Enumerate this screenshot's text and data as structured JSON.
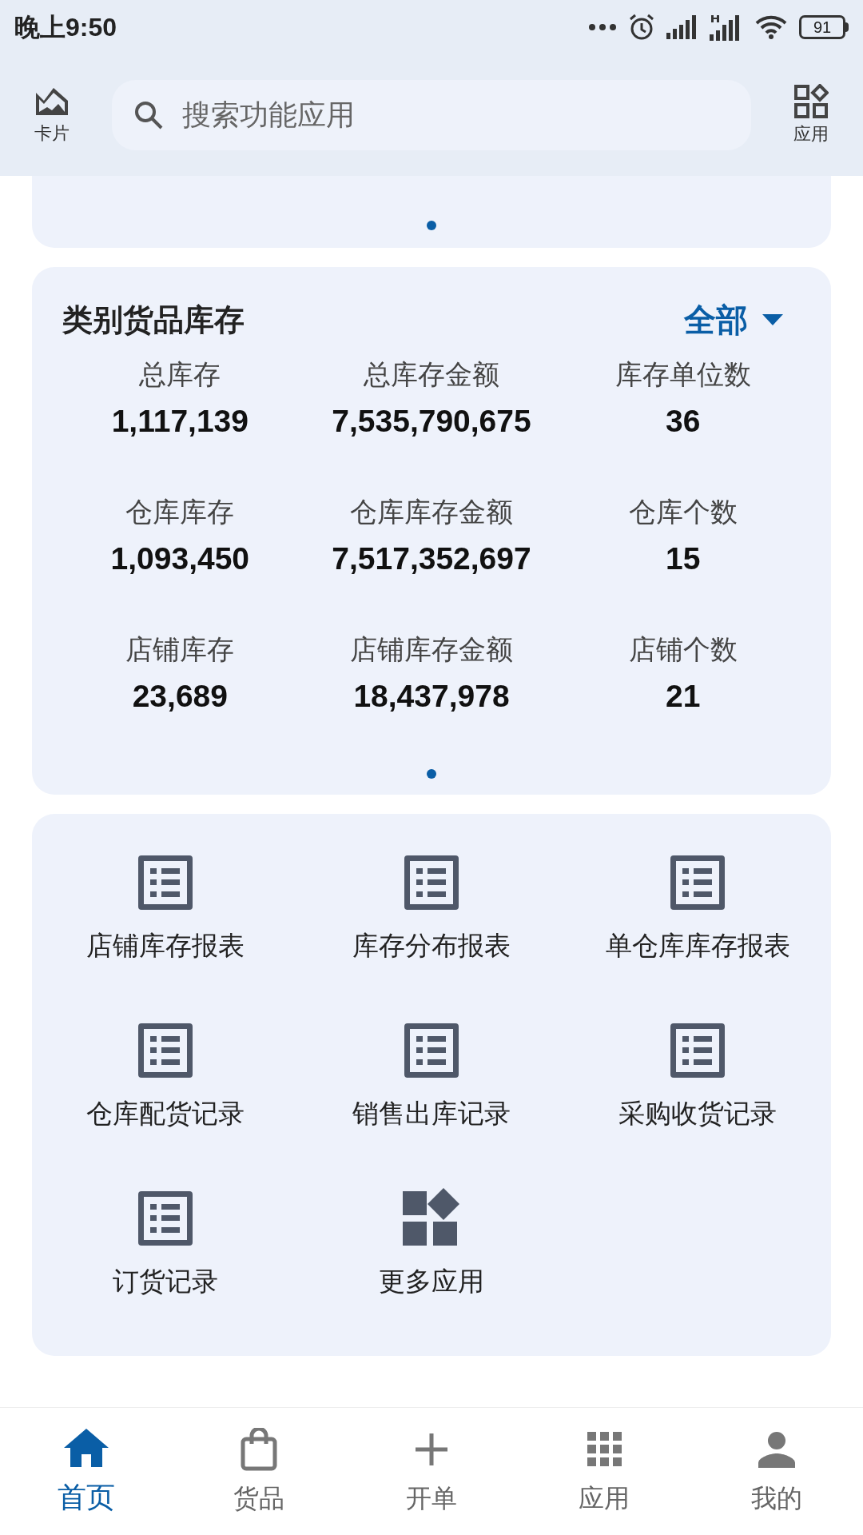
{
  "status_bar": {
    "time": "晚上9:50",
    "battery": "91"
  },
  "header": {
    "left_label": "卡片",
    "search": {
      "placeholder": "搜索功能应用"
    },
    "right_label": "应用"
  },
  "stock_card": {
    "title": "类别货品库存",
    "filter": "全部",
    "stats": [
      {
        "label": "总库存",
        "value": "1,117,139"
      },
      {
        "label": "总库存金额",
        "value": "7,535,790,675"
      },
      {
        "label": "库存单位数",
        "value": "36"
      },
      {
        "label": "仓库库存",
        "value": "1,093,450"
      },
      {
        "label": "仓库库存金额",
        "value": "7,517,352,697"
      },
      {
        "label": "仓库个数",
        "value": "15"
      },
      {
        "label": "店铺库存",
        "value": "23,689"
      },
      {
        "label": "店铺库存金额",
        "value": "18,437,978"
      },
      {
        "label": "店铺个数",
        "value": "21"
      }
    ]
  },
  "apps": [
    {
      "label": "店铺库存报表",
      "kind": "report"
    },
    {
      "label": "库存分布报表",
      "kind": "report"
    },
    {
      "label": "单仓库库存报表",
      "kind": "report"
    },
    {
      "label": "仓库配货记录",
      "kind": "report"
    },
    {
      "label": "销售出库记录",
      "kind": "report"
    },
    {
      "label": "采购收货记录",
      "kind": "report"
    },
    {
      "label": "订货记录",
      "kind": "report"
    },
    {
      "label": "更多应用",
      "kind": "more"
    }
  ],
  "bottom_nav": [
    {
      "label": "首页",
      "kind": "home",
      "selected": true
    },
    {
      "label": "货品",
      "kind": "bag",
      "selected": false
    },
    {
      "label": "开单",
      "kind": "plus",
      "selected": false
    },
    {
      "label": "应用",
      "kind": "grid",
      "selected": false
    },
    {
      "label": "我的",
      "kind": "person",
      "selected": false
    }
  ]
}
